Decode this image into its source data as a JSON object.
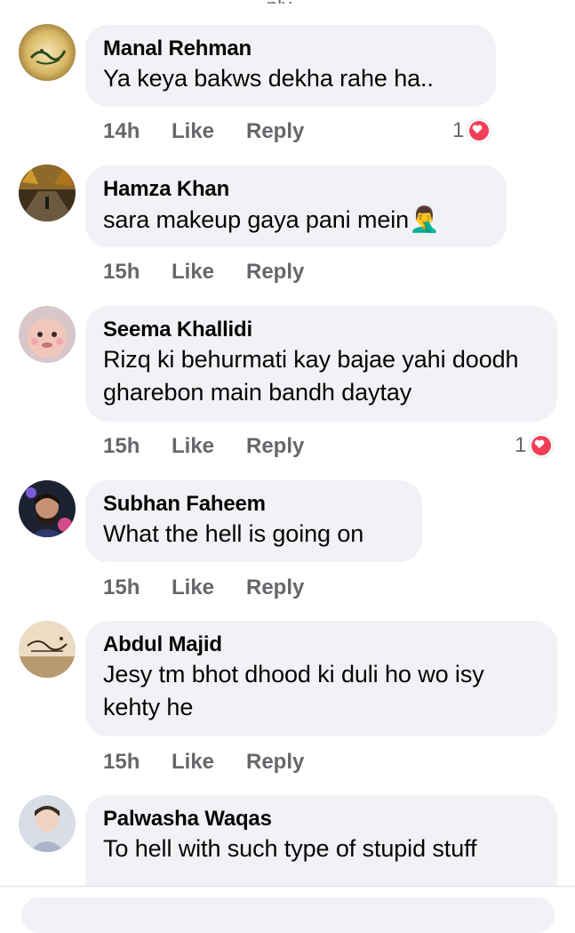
{
  "comments": [
    {
      "author": "Manal Rehman",
      "text": "Ya keya bakws dekha rahe ha..",
      "time": "14h",
      "like_label": "Like",
      "reply_label": "Reply",
      "reaction_count": "1"
    },
    {
      "author": "Hamza Khan",
      "text": "sara makeup gaya pani mein",
      "emoji": "🤦‍♂️",
      "time": "15h",
      "like_label": "Like",
      "reply_label": "Reply"
    },
    {
      "author": "Seema Khallidi",
      "text": "Rizq ki behurmati kay bajae yahi doodh gharebon main bandh daytay",
      "time": "15h",
      "like_label": "Like",
      "reply_label": "Reply",
      "reaction_count": "1"
    },
    {
      "author": "Subhan Faheem",
      "text": "What the hell is going on",
      "time": "15h",
      "like_label": "Like",
      "reply_label": "Reply"
    },
    {
      "author": "Abdul Majid",
      "text": "Jesy tm bhot dhood ki duli ho wo isy kehty he",
      "time": "15h",
      "like_label": "Like",
      "reply_label": "Reply"
    },
    {
      "author": "Palwasha Waqas",
      "text": "To hell with such type of stupid stuff",
      "time": "",
      "like_label": "",
      "reply_label": ""
    }
  ],
  "colors": {
    "bubble": "#f0f2f5",
    "meta_text": "#65676b",
    "heart": "#f33e58"
  },
  "icons": {
    "reaction": "heart-icon"
  }
}
